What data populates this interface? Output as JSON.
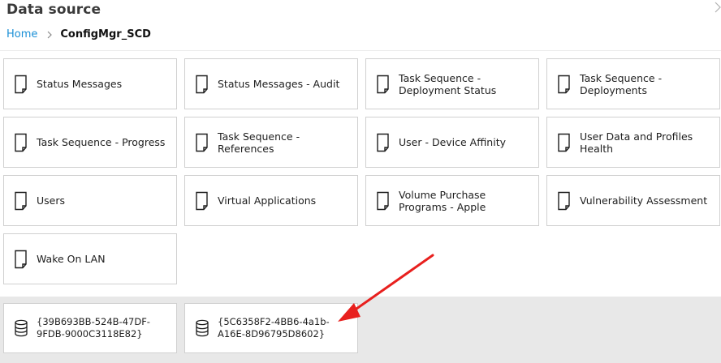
{
  "header": {
    "title": "Data source",
    "close_icon": "chevron-right-icon"
  },
  "breadcrumb": {
    "home": "Home",
    "current": "ConfigMgr_SCD"
  },
  "reports": [
    {
      "label": "Status Messages",
      "icon": "report-icon"
    },
    {
      "label": "Status Messages - Audit",
      "icon": "report-icon"
    },
    {
      "label": "Task Sequence - Deployment Status",
      "icon": "report-icon"
    },
    {
      "label": "Task Sequence - Deployments",
      "icon": "report-icon"
    },
    {
      "label": "Task Sequence - Progress",
      "icon": "report-icon"
    },
    {
      "label": "Task Sequence - References",
      "icon": "report-icon"
    },
    {
      "label": "User - Device Affinity",
      "icon": "report-icon"
    },
    {
      "label": "User Data and Profiles Health",
      "icon": "report-icon"
    },
    {
      "label": "Users",
      "icon": "report-icon"
    },
    {
      "label": "Virtual Applications",
      "icon": "report-icon"
    },
    {
      "label": "Volume Purchase Programs - Apple",
      "icon": "report-icon"
    },
    {
      "label": "Vulnerability Assessment",
      "icon": "report-icon"
    },
    {
      "label": "Wake On LAN",
      "icon": "report-icon"
    }
  ],
  "datasources": [
    {
      "label": "{39B693BB-524B-47DF-9FDB-9000C3118E82}",
      "icon": "database-icon"
    },
    {
      "label": "{5C6358F2-4BB6-4a1b-A16E-8D96795D8602}",
      "icon": "database-icon"
    }
  ],
  "annotation": {
    "color": "#e8201e"
  }
}
